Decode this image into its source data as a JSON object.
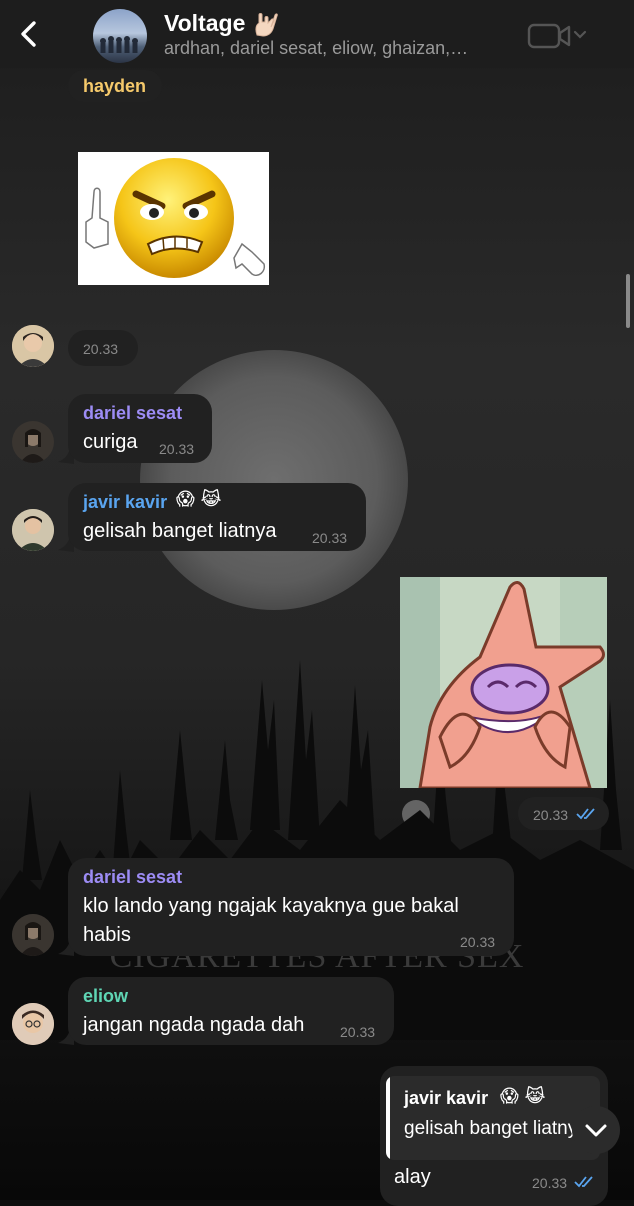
{
  "header": {
    "title": "Voltage",
    "members": "ardhan, dariel sesat, eliow, ghaizan,…"
  },
  "wallpaper": {
    "text": "CIGARETTES AFTER SEX"
  },
  "messages": {
    "hayden": {
      "sender": "hayden",
      "color": "#f5c96b"
    },
    "hayden_sticker_time": {
      "time": "20.33"
    },
    "dariel1": {
      "sender": "dariel sesat",
      "text": "curiga",
      "time": "20.33",
      "color": "#9d8cf5"
    },
    "javir": {
      "sender": "javir kavir",
      "emojis": "😱 😹",
      "text": "gelisah banget liatnya",
      "time": "20.33",
      "color": "#5aa5f0"
    },
    "own_sticker": {
      "time": "20.33"
    },
    "dariel2": {
      "sender": "dariel sesat",
      "line1": "klo lando yang ngajak kayaknya gue bakal",
      "line2": "habis",
      "time": "20.33",
      "color": "#9d8cf5"
    },
    "eliow": {
      "sender": "eliow",
      "text": "jangan ngada ngada dah",
      "time": "20.33",
      "color": "#5fd6b5"
    },
    "own_reply": {
      "quote_sender": "javir kavir",
      "quote_emojis": "😱 😹",
      "quote_text": "gelisah banget liatnya",
      "text": "alay",
      "time": "20.33"
    }
  },
  "colors": {
    "bubble": "#212121",
    "accent_read": "#5aa5f0",
    "header": "#1d1d1d"
  }
}
